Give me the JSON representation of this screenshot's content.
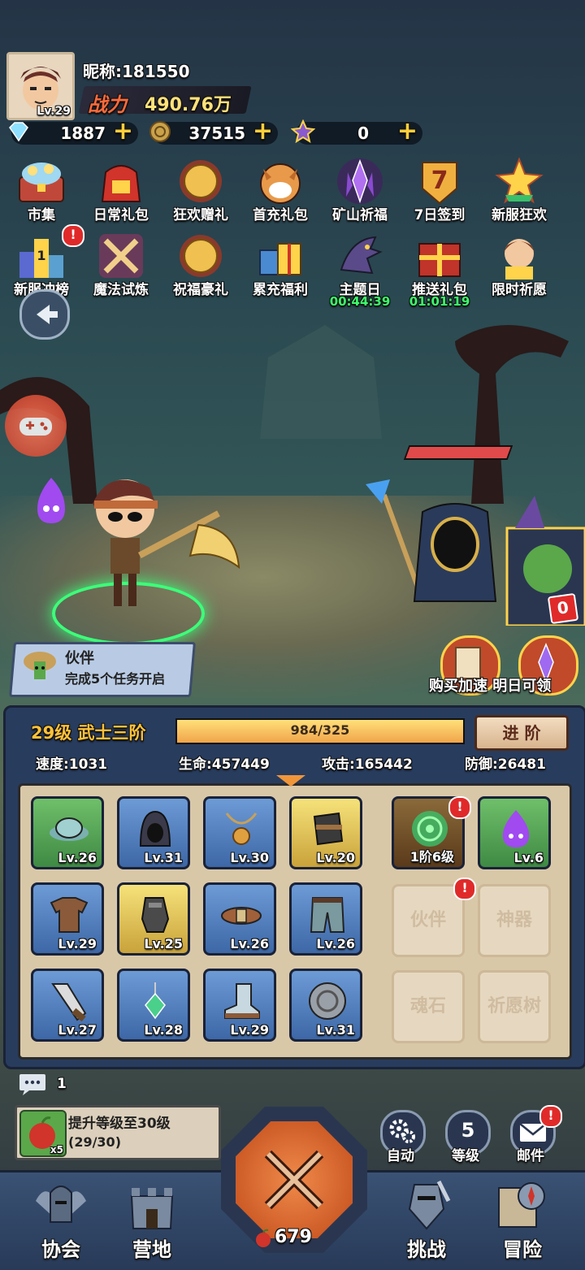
{
  "player": {
    "level": "Lv.29",
    "nickname": "昵称:181550",
    "power_label": "战力",
    "power_value": "490.76万"
  },
  "resources": [
    {
      "icon": "diamond-icon",
      "value": "1887"
    },
    {
      "icon": "coin-icon",
      "value": "37515"
    },
    {
      "icon": "star-icon",
      "value": "0"
    }
  ],
  "activities_row1": [
    {
      "label": "市集",
      "icon": "treasure-chest-icon"
    },
    {
      "label": "日常礼包",
      "icon": "red-gift-bag-icon"
    },
    {
      "label": "狂欢赠礼",
      "icon": "gold-orb-icon"
    },
    {
      "label": "首充礼包",
      "icon": "shiba-dog-icon"
    },
    {
      "label": "矿山祈福",
      "icon": "purple-crystal-icon"
    },
    {
      "label": "7日签到",
      "icon": "seven-day-badge-icon"
    },
    {
      "label": "新服狂欢",
      "icon": "star-celebration-icon"
    }
  ],
  "activities_row2": [
    {
      "label": "新服冲榜",
      "icon": "ranking-podium-icon",
      "timer": ""
    },
    {
      "label": "魔法试炼",
      "icon": "crossed-swords-icon",
      "timer": ""
    },
    {
      "label": "祝福豪礼",
      "icon": "gold-orb-icon",
      "timer": ""
    },
    {
      "label": "累充福利",
      "icon": "gift-boxes-icon",
      "timer": ""
    },
    {
      "label": "主题日",
      "icon": "dragon-icon",
      "timer": "00:44:39"
    },
    {
      "label": "推送礼包",
      "icon": "red-gift-box-icon",
      "timer": "01:01:19"
    },
    {
      "label": "限时祈愿",
      "icon": "hero-portrait-icon",
      "timer": ""
    }
  ],
  "scene": {
    "enemy_badge": "0",
    "partner_title": "伙伴",
    "partner_desc": "完成5个任务开启",
    "promo_text": "购买加速 明日可领"
  },
  "stats": {
    "rank": "29级 武士三阶",
    "xp_text": "984/325",
    "xp_fraction": 1.0,
    "advance_label": "进 阶",
    "speed": "速度:1031",
    "hp": "生命:457449",
    "attack": "攻击:165442",
    "defense": "防御:26481"
  },
  "equipment": [
    {
      "lv": "Lv.26",
      "rarity": "green",
      "icon": "hat-icon"
    },
    {
      "lv": "Lv.31",
      "rarity": "blue",
      "icon": "hood-icon"
    },
    {
      "lv": "Lv.30",
      "rarity": "blue",
      "icon": "necklace-icon"
    },
    {
      "lv": "Lv.20",
      "rarity": "gold",
      "icon": "bracer-icon"
    },
    {
      "lv": "Lv.29",
      "rarity": "blue",
      "icon": "armor-icon"
    },
    {
      "lv": "Lv.25",
      "rarity": "gold",
      "icon": "gauntlet-icon"
    },
    {
      "lv": "Lv.26",
      "rarity": "blue",
      "icon": "belt-icon"
    },
    {
      "lv": "Lv.26",
      "rarity": "blue",
      "icon": "pants-icon"
    },
    {
      "lv": "Lv.27",
      "rarity": "blue",
      "icon": "blade-icon"
    },
    {
      "lv": "Lv.28",
      "rarity": "blue",
      "icon": "gem-earring-icon"
    },
    {
      "lv": "Lv.29",
      "rarity": "blue",
      "icon": "boots-icon"
    },
    {
      "lv": "Lv.31",
      "rarity": "blue",
      "icon": "shield-icon"
    }
  ],
  "side_slots": {
    "rune": "1阶6级",
    "spirit": "Lv.6",
    "locked": [
      "伙伴",
      "神器",
      "魂石",
      "祈愿树"
    ]
  },
  "chat": {
    "count": "1"
  },
  "quest": {
    "title": "提升等级至30级",
    "progress": "(29/30)",
    "reward_count": "x5"
  },
  "buttons": {
    "auto": "自动",
    "level_num": "5",
    "level": "等级",
    "mail": "邮件"
  },
  "nav": {
    "guild": "协会",
    "camp": "营地",
    "stamina": "679",
    "challenge": "挑战",
    "adventure": "冒险"
  },
  "colors": {
    "panel": "#283c5e",
    "gold_text": "#ffc23a",
    "timer": "#3cff6a",
    "alert": "#e02a2a"
  }
}
